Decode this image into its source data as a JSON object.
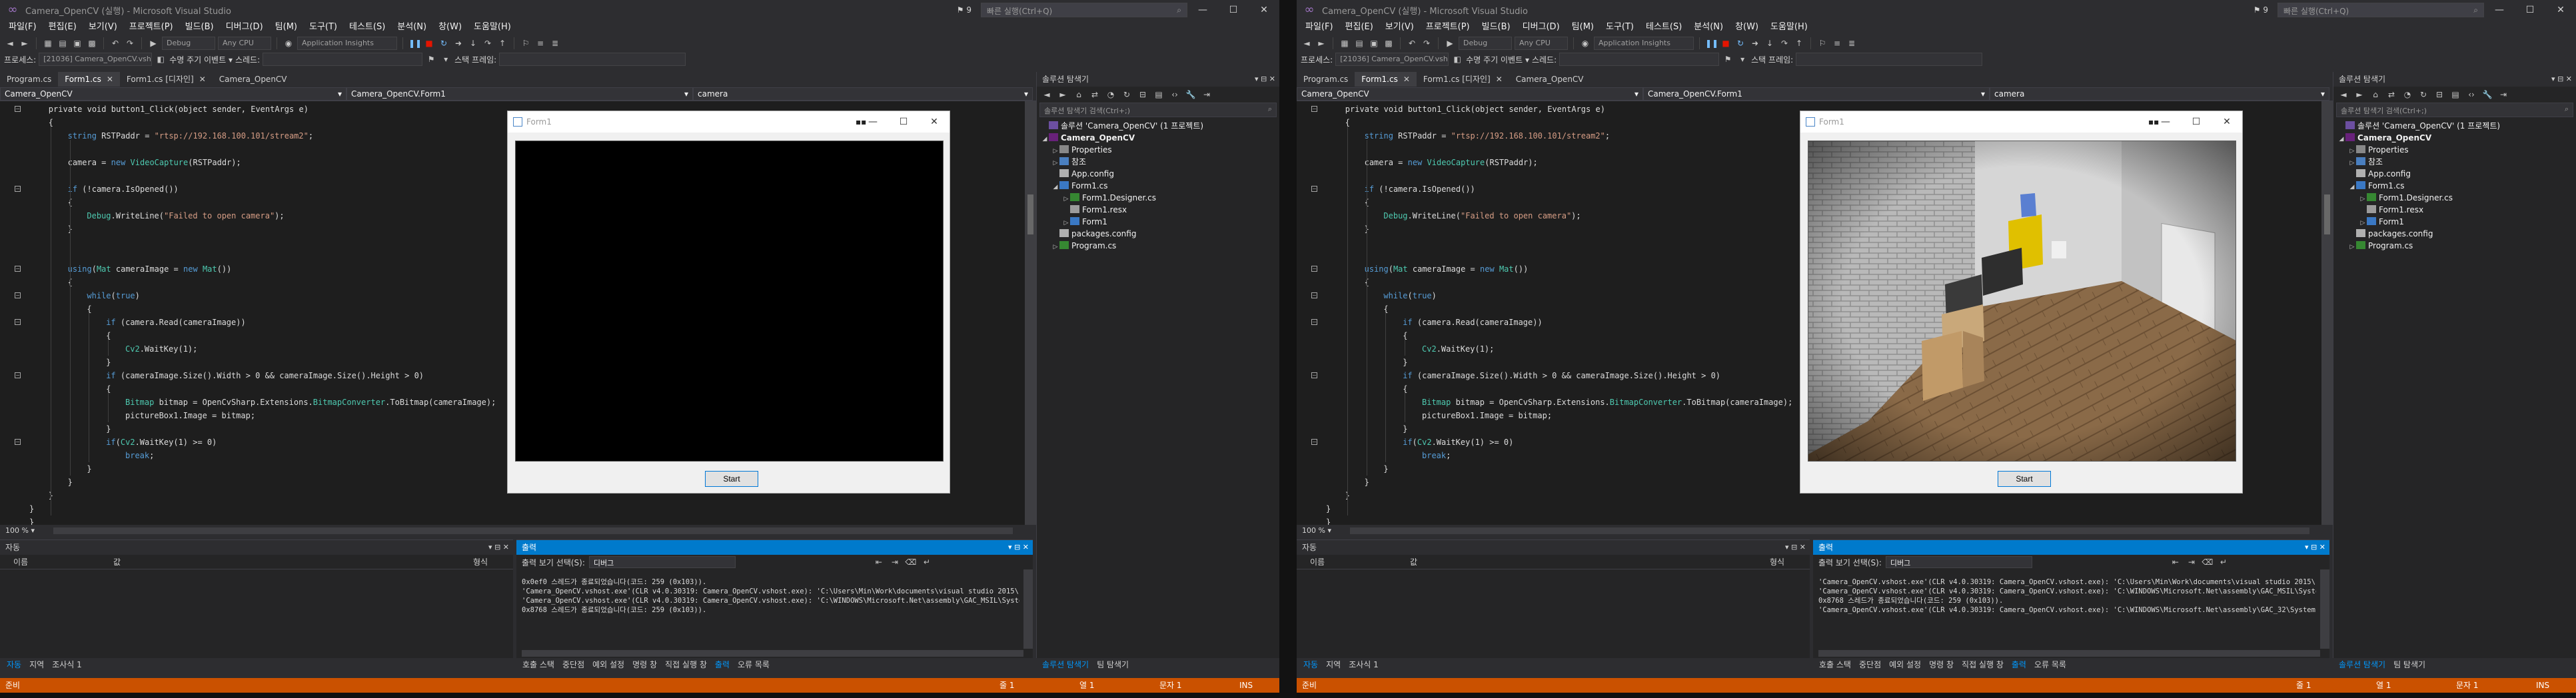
{
  "app": {
    "title": "Camera_OpenCV (실행) - Microsoft Visual Studio",
    "notification_count": "9",
    "quick_launch_placeholder": "빠른 실행(Ctrl+Q)",
    "logo": "visual-studio-logo"
  },
  "menu": [
    "파일(F)",
    "편집(E)",
    "보기(V)",
    "프로젝트(P)",
    "빌드(B)",
    "디버그(D)",
    "팀(M)",
    "도구(T)",
    "테스트(S)",
    "분석(N)",
    "창(W)",
    "도움말(H)"
  ],
  "toolbar": {
    "config": "Debug",
    "platform": "Any CPU",
    "insights": "Application Insights",
    "process_label": "프로세스:",
    "process_value": "[21036] Camera_OpenCV.vshost.e",
    "lifecycle_label": "수명 주기 이벤트 ▾",
    "thread_label": "스레드:",
    "stackframe_label": "스택 프레임:"
  },
  "doc_tabs": [
    {
      "label": "Program.cs",
      "active": false,
      "close": false
    },
    {
      "label": "Form1.cs",
      "active": true,
      "close": true
    },
    {
      "label": "Form1.cs [디자인]",
      "active": false,
      "close": true
    },
    {
      "label": "Camera_OpenCV",
      "active": false,
      "close": false
    }
  ],
  "nav": {
    "project": "Camera_OpenCV",
    "class": "Camera_OpenCV.Form1",
    "member": "camera"
  },
  "code_lines": [
    {
      "indent": 1,
      "parts": [
        {
          "t": "private void button1_Click(object sender, EventArgs e)",
          "c": "cm"
        }
      ]
    },
    {
      "indent": 1,
      "parts": [
        {
          "t": "{",
          "c": "cm"
        }
      ]
    },
    {
      "indent": 2,
      "parts": [
        {
          "t": "string",
          "c": "kw"
        },
        {
          "t": " RSTPaddr = ",
          "c": "cm"
        },
        {
          "t": "\"rtsp://192.168.100.101/stream2\"",
          "c": "str"
        },
        {
          "t": ";",
          "c": "cm"
        }
      ]
    },
    {
      "indent": 0,
      "parts": []
    },
    {
      "indent": 2,
      "parts": [
        {
          "t": "camera = ",
          "c": "cm"
        },
        {
          "t": "new",
          "c": "kw"
        },
        {
          "t": " ",
          "c": "cm"
        },
        {
          "t": "VideoCapture",
          "c": "ty"
        },
        {
          "t": "(RSTPaddr);",
          "c": "cm"
        }
      ]
    },
    {
      "indent": 0,
      "parts": []
    },
    {
      "indent": 2,
      "parts": [
        {
          "t": "if",
          "c": "kw"
        },
        {
          "t": " (!camera.IsOpened())",
          "c": "cm"
        }
      ]
    },
    {
      "indent": 2,
      "parts": [
        {
          "t": "{",
          "c": "cm"
        }
      ]
    },
    {
      "indent": 3,
      "parts": [
        {
          "t": "Debug",
          "c": "ty"
        },
        {
          "t": ".WriteLine(",
          "c": "cm"
        },
        {
          "t": "\"Failed to open camera\"",
          "c": "str"
        },
        {
          "t": ");",
          "c": "cm"
        }
      ]
    },
    {
      "indent": 2,
      "parts": [
        {
          "t": "}",
          "c": "cm"
        }
      ]
    },
    {
      "indent": 0,
      "parts": []
    },
    {
      "indent": 0,
      "parts": []
    },
    {
      "indent": 2,
      "parts": [
        {
          "t": "using",
          "c": "kw"
        },
        {
          "t": "(",
          "c": "cm"
        },
        {
          "t": "Mat",
          "c": "ty"
        },
        {
          "t": " cameraImage = ",
          "c": "cm"
        },
        {
          "t": "new",
          "c": "kw"
        },
        {
          "t": " ",
          "c": "cm"
        },
        {
          "t": "Mat",
          "c": "ty"
        },
        {
          "t": "())",
          "c": "cm"
        }
      ]
    },
    {
      "indent": 2,
      "parts": [
        {
          "t": "{",
          "c": "cm"
        }
      ]
    },
    {
      "indent": 3,
      "parts": [
        {
          "t": "while",
          "c": "kw"
        },
        {
          "t": "(",
          "c": "cm"
        },
        {
          "t": "true",
          "c": "kw"
        },
        {
          "t": ")",
          "c": "cm"
        }
      ]
    },
    {
      "indent": 3,
      "parts": [
        {
          "t": "{",
          "c": "cm"
        }
      ]
    },
    {
      "indent": 4,
      "parts": [
        {
          "t": "if",
          "c": "kw"
        },
        {
          "t": " (camera.Read(cameraImage))",
          "c": "cm"
        }
      ]
    },
    {
      "indent": 4,
      "parts": [
        {
          "t": "{",
          "c": "cm"
        }
      ]
    },
    {
      "indent": 5,
      "parts": [
        {
          "t": "Cv2",
          "c": "ty"
        },
        {
          "t": ".WaitKey(1);",
          "c": "cm"
        }
      ]
    },
    {
      "indent": 4,
      "parts": [
        {
          "t": "}",
          "c": "cm"
        }
      ]
    },
    {
      "indent": 4,
      "parts": [
        {
          "t": "if",
          "c": "kw"
        },
        {
          "t": " (cameraImage.Size().Width > 0 && cameraImage.Size().Height > 0)",
          "c": "cm"
        }
      ]
    },
    {
      "indent": 4,
      "parts": [
        {
          "t": "{",
          "c": "cm"
        }
      ]
    },
    {
      "indent": 5,
      "parts": [
        {
          "t": "Bitmap",
          "c": "ty"
        },
        {
          "t": " bitmap = OpenCvSharp.Extensions.",
          "c": "cm"
        },
        {
          "t": "BitmapConverter",
          "c": "ty"
        },
        {
          "t": ".ToBitmap(cameraImage);",
          "c": "cm"
        }
      ]
    },
    {
      "indent": 5,
      "parts": [
        {
          "t": "pictureBox1.Image = bitmap;",
          "c": "cm"
        }
      ]
    },
    {
      "indent": 4,
      "parts": [
        {
          "t": "}",
          "c": "cm"
        }
      ]
    },
    {
      "indent": 4,
      "parts": [
        {
          "t": "if",
          "c": "kw"
        },
        {
          "t": "(",
          "c": "cm"
        },
        {
          "t": "Cv2",
          "c": "ty"
        },
        {
          "t": ".WaitKey(1) >= 0)",
          "c": "cm"
        }
      ]
    },
    {
      "indent": 5,
      "parts": [
        {
          "t": "break",
          "c": "kw"
        },
        {
          "t": ";",
          "c": "cm"
        }
      ]
    },
    {
      "indent": 3,
      "parts": [
        {
          "t": "}",
          "c": "cm"
        }
      ]
    },
    {
      "indent": 2,
      "parts": [
        {
          "t": "}",
          "c": "cm"
        }
      ]
    },
    {
      "indent": 1,
      "parts": [
        {
          "t": "}",
          "c": "cm"
        }
      ]
    },
    {
      "indent": 0,
      "parts": [
        {
          "t": "}",
          "c": "cm"
        }
      ]
    },
    {
      "indent": 0,
      "parts": [
        {
          "t": "}",
          "c": "cm"
        }
      ]
    }
  ],
  "zoom": "100 %",
  "form": {
    "title": "Form1",
    "start_button": "Start",
    "picture_left_state": "empty",
    "picture_right_state": "camera-feed"
  },
  "solution_explorer": {
    "title": "솔루션 탐색기",
    "search_placeholder": "솔루션 탐색기 검색(Ctrl+;)",
    "tree": [
      {
        "label": "솔루션 'Camera_OpenCV' (1 프로젝트)",
        "level": 0,
        "icon": "ic-sln",
        "arrow": "",
        "bold": false
      },
      {
        "label": "Camera_OpenCV",
        "level": 0,
        "icon": "ic-proj",
        "arrow": "◢",
        "bold": true
      },
      {
        "label": "Properties",
        "level": 1,
        "icon": "ic-wrench",
        "arrow": "▷",
        "bold": false
      },
      {
        "label": "참조",
        "level": 1,
        "icon": "ic-ref",
        "arrow": "▷",
        "bold": false
      },
      {
        "label": "App.config",
        "level": 1,
        "icon": "ic-cfg",
        "arrow": "",
        "bold": false
      },
      {
        "label": "Form1.cs",
        "level": 1,
        "icon": "ic-form",
        "arrow": "◢",
        "bold": false
      },
      {
        "label": "Form1.Designer.cs",
        "level": 2,
        "icon": "ic-cs",
        "arrow": "▷",
        "bold": false
      },
      {
        "label": "Form1.resx",
        "level": 2,
        "icon": "ic-resx",
        "arrow": "",
        "bold": false
      },
      {
        "label": "Form1",
        "level": 2,
        "icon": "ic-form",
        "arrow": "▷",
        "bold": false
      },
      {
        "label": "packages.config",
        "level": 1,
        "icon": "ic-cfg",
        "arrow": "",
        "bold": false
      },
      {
        "label": "Program.cs",
        "level": 1,
        "icon": "ic-cs",
        "arrow": "▷",
        "bold": false
      }
    ],
    "tabs": [
      "솔루션 탐색기",
      "팀 탐색기"
    ]
  },
  "autos": {
    "title": "자동",
    "col_name": "이름",
    "col_value": "값",
    "col_type": "형식",
    "tabs": [
      "자동",
      "지역",
      "조사식 1"
    ]
  },
  "output": {
    "title": "출력",
    "source_label": "출력 보기 선택(S):",
    "source_value": "디버그",
    "lines_left": [
      "0x0ef0 스레드가 종료되었습니다(코드: 259 (0x103)).",
      "'Camera_OpenCV.vshost.exe'(CLR v4.0.30319: Camera_OpenCV.vshost.exe): 'C:\\Users\\Min\\Work\\documents\\visual studio 2015\\Projects",
      "'Camera_OpenCV.vshost.exe'(CLR v4.0.30319: Camera_OpenCV.vshost.exe): 'C:\\WINDOWS\\Microsoft.Net\\assembly\\GAC_MSIL\\System.Con",
      "0x8768 스레드가 종료되었습니다(코드: 259 (0x103))."
    ],
    "lines_right": [
      "'Camera_OpenCV.vshost.exe'(CLR v4.0.30319: Camera_OpenCV.vshost.exe): 'C:\\Users\\Min\\Work\\documents\\visual studio 2015\\Projects",
      "'Camera_OpenCV.vshost.exe'(CLR v4.0.30319: Camera_OpenCV.vshost.exe): 'C:\\WINDOWS\\Microsoft.Net\\assembly\\GAC_MSIL\\System.Con",
      "0x8768 스레드가 종료되었습니다(코드: 259 (0x103)).",
      "'Camera_OpenCV.vshost.exe'(CLR v4.0.30319: Camera_OpenCV.vshost.exe): 'C:\\WINDOWS\\Microsoft.Net\\assembly\\GAC_32\\System.Web\\"
    ],
    "tabs": [
      "호출 스택",
      "중단점",
      "예외 설정",
      "명령 창",
      "직접 실행 창",
      "출력",
      "오류 목록"
    ]
  },
  "status": {
    "left": "준비",
    "line": "줄 1",
    "col": "열 1",
    "char": "문자 1",
    "mode": "INS"
  },
  "colors": {
    "status_bar": "#ca5100",
    "accent": "#007acc",
    "editor_bg": "#1e1e1e"
  }
}
